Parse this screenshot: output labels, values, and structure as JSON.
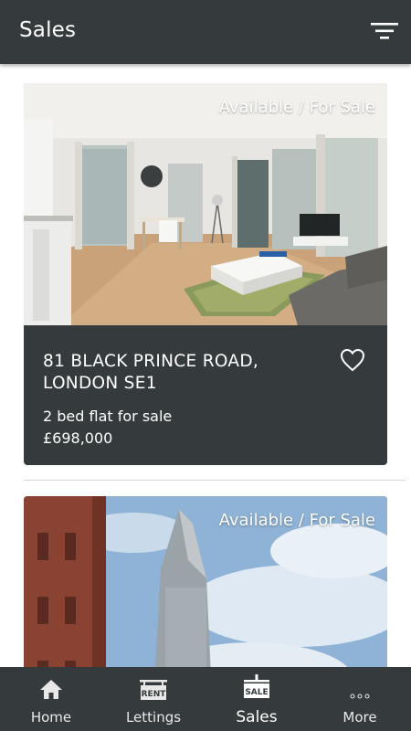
{
  "header": {
    "title": "Sales",
    "filter_icon": "filter-icon"
  },
  "listings": [
    {
      "status": "Available / For Sale",
      "address": "81 BLACK PRINCE ROAD, LONDON SE1",
      "description": "2 bed flat for sale",
      "price": "£698,000",
      "favourite_icon": "heart-outline-icon"
    },
    {
      "status": "Available / For Sale"
    }
  ],
  "bottom_nav": {
    "items": [
      {
        "label": "Home",
        "icon": "home-icon"
      },
      {
        "label": "Lettings",
        "icon": "rent-sign-icon",
        "icon_text": "RENT"
      },
      {
        "label": "Sales",
        "icon": "sale-sign-icon",
        "icon_text": "SALE",
        "active": true
      },
      {
        "label": "More",
        "icon": "more-dots-icon"
      }
    ]
  },
  "colors": {
    "bar": "#353b3d",
    "card": "#353b3d",
    "text": "#ffffff"
  }
}
